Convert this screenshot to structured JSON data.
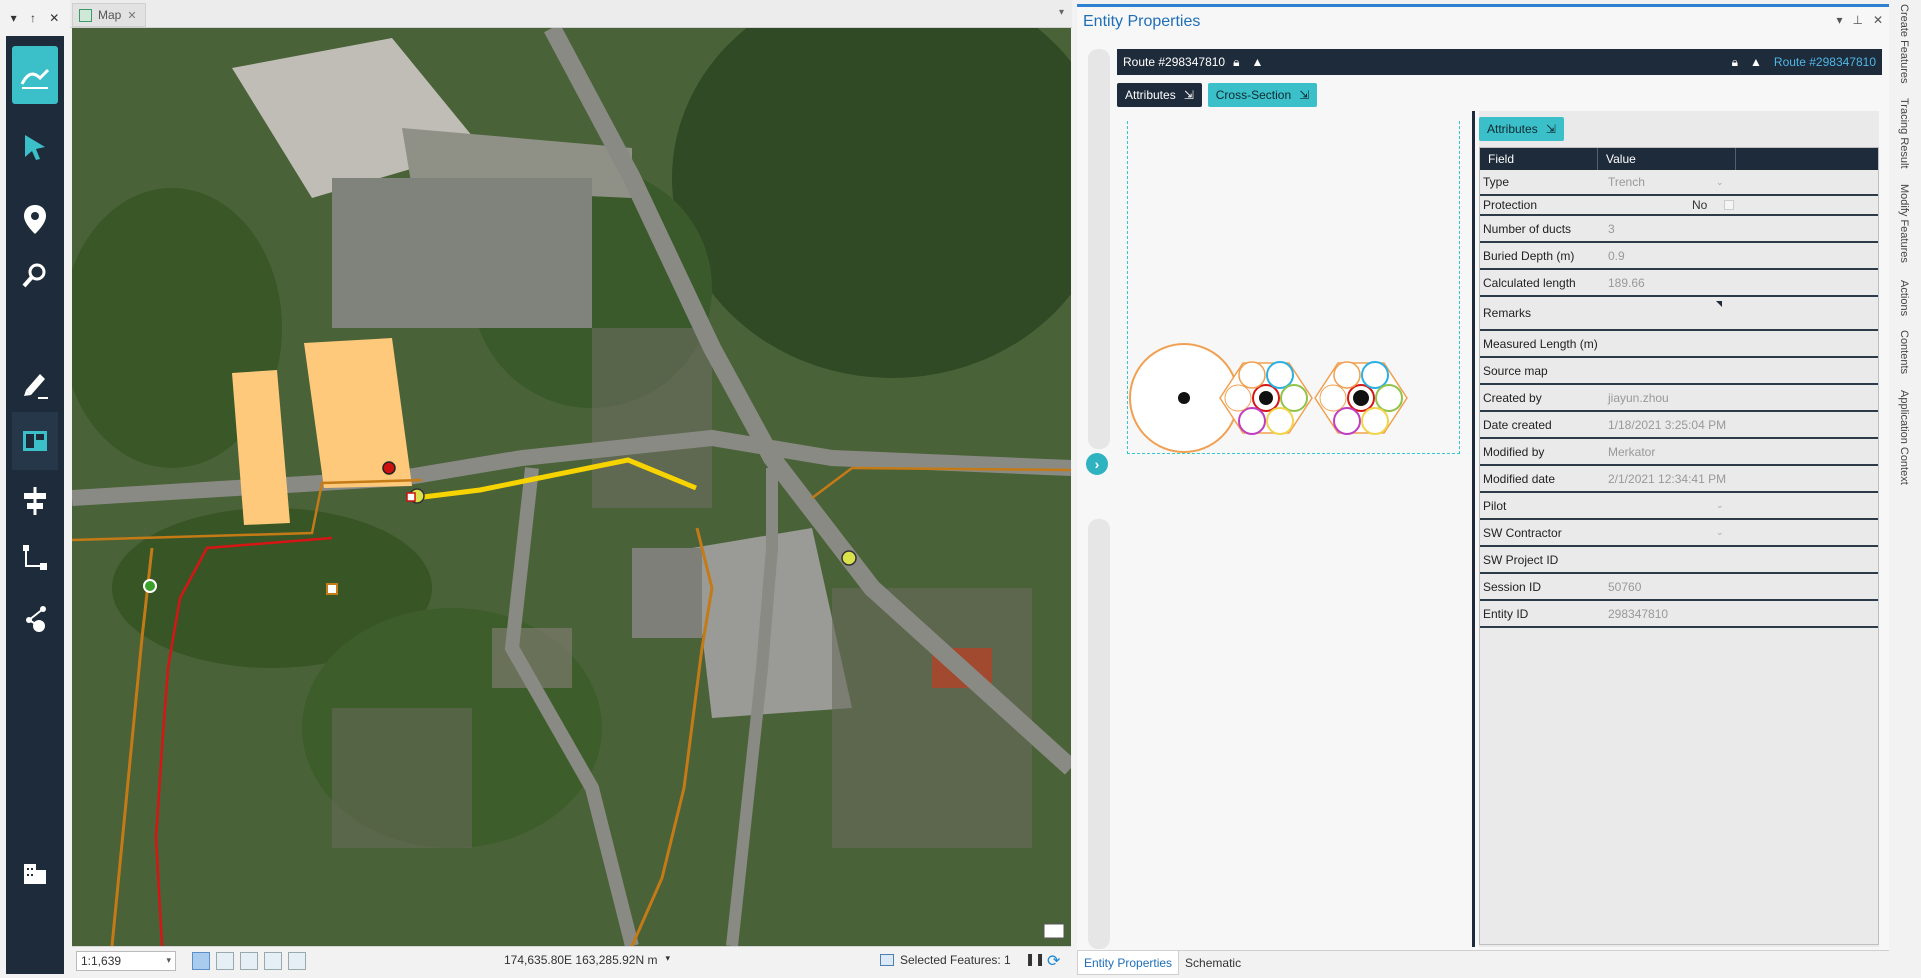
{
  "left_header": {
    "pin": "↑",
    "close": "✕",
    "menu": "▾"
  },
  "map": {
    "tab_label": "Map",
    "tab_close": "✕",
    "status": {
      "scale": "1:1,639",
      "coordinates": "174,635.80E 163,285.92N m",
      "selected_features": "Selected Features: 1"
    }
  },
  "panel": {
    "title": "Entity Properties",
    "route_label": "Route #298347810",
    "route_link": "Route #298347810",
    "tabs": {
      "attributes": "Attributes",
      "cross_section": "Cross-Section"
    },
    "attr_tab": "Attributes",
    "columns": {
      "field": "Field",
      "value": "Value"
    },
    "rows": [
      {
        "field": "Type",
        "value": "Trench",
        "dropdown": true,
        "h": 26
      },
      {
        "field": "Protection",
        "value": "",
        "no": "No",
        "h": 20
      },
      {
        "field": "Number of ducts",
        "value": "3",
        "h": 27
      },
      {
        "field": "Buried Depth (m)",
        "value": "0.9",
        "h": 27
      },
      {
        "field": "Calculated length",
        "value": "189.66",
        "h": 27
      },
      {
        "field": "Remarks",
        "value": "",
        "tri": true,
        "h": 34
      },
      {
        "field": "Measured Length (m)",
        "value": "",
        "h": 27
      },
      {
        "field": "Source map",
        "value": "",
        "h": 27
      },
      {
        "field": "Created by",
        "value": "jiayun.zhou",
        "h": 27
      },
      {
        "field": "Date created",
        "value": "1/18/2021 3:25:04 PM",
        "h": 27
      },
      {
        "field": "Modified by",
        "value": "Merkator",
        "h": 27
      },
      {
        "field": "Modified date",
        "value": "2/1/2021 12:34:41 PM",
        "h": 27
      },
      {
        "field": "Pilot",
        "value": "",
        "dropdown": true,
        "h": 27
      },
      {
        "field": "SW Contractor",
        "value": "",
        "dropdown": true,
        "h": 27
      },
      {
        "field": "SW Project ID",
        "value": "",
        "h": 27
      },
      {
        "field": "Session ID",
        "value": "50760",
        "h": 27
      },
      {
        "field": "Entity ID",
        "value": "298347810",
        "h": 27
      }
    ]
  },
  "bottom_tabs": [
    "Entity Properties",
    "Schematic"
  ],
  "side_tabs": [
    "Create Features",
    "Tracing Result",
    "Modify Features",
    "Actions",
    "Contents",
    "Application Context"
  ]
}
